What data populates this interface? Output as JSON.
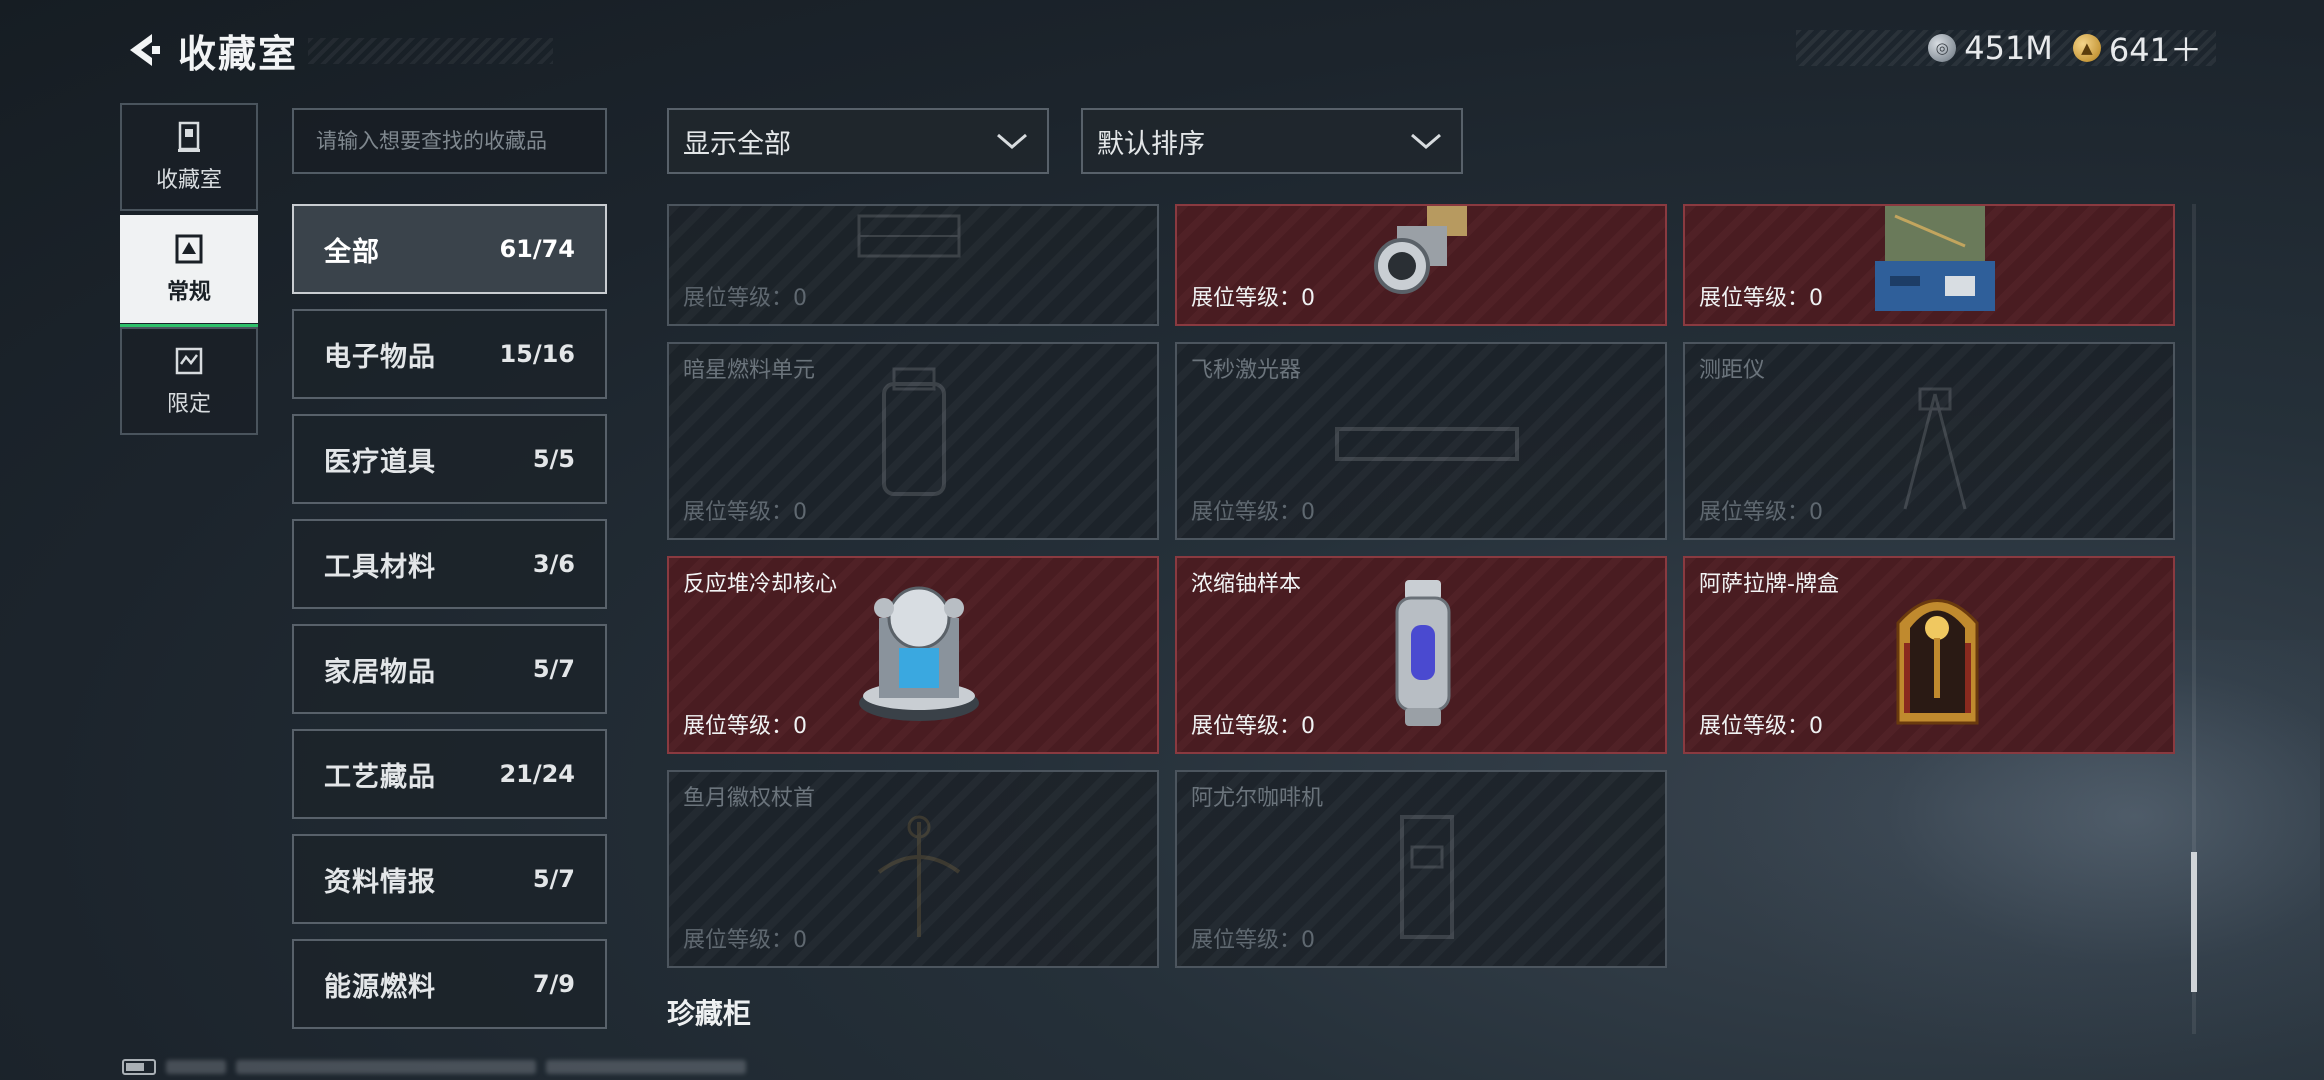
{
  "header": {
    "title": "收藏室",
    "currencies": [
      {
        "icon": "silver-coin-icon",
        "value": "451M"
      },
      {
        "icon": "gold-coin-icon",
        "value": "641＋"
      }
    ]
  },
  "left_nav": [
    {
      "label": "收藏室",
      "icon": "display-case-icon",
      "active": false
    },
    {
      "label": "常规",
      "icon": "regular-collection-icon",
      "active": true
    },
    {
      "label": "限定",
      "icon": "limited-collection-icon",
      "active": false
    }
  ],
  "search": {
    "placeholder": "请输入想要查找的收藏品",
    "value": ""
  },
  "categories": [
    {
      "name": "全部",
      "count": "61/74",
      "active": true
    },
    {
      "name": "电子物品",
      "count": "15/16",
      "active": false
    },
    {
      "name": "医疗道具",
      "count": "5/5",
      "active": false
    },
    {
      "name": "工具材料",
      "count": "3/6",
      "active": false
    },
    {
      "name": "家居物品",
      "count": "5/7",
      "active": false
    },
    {
      "name": "工艺藏品",
      "count": "21/24",
      "active": false
    },
    {
      "name": "资料情报",
      "count": "5/7",
      "active": false
    },
    {
      "name": "能源燃料",
      "count": "7/9",
      "active": false
    }
  ],
  "filters": {
    "display": "显示全部",
    "sort": "默认排序"
  },
  "items": [
    {
      "name": "",
      "level": "展位等级：0",
      "owned": false
    },
    {
      "name": "",
      "level": "展位等级：0",
      "owned": true
    },
    {
      "name": "",
      "level": "展位等级：0",
      "owned": true
    },
    {
      "name": "暗星燃料单元",
      "level": "展位等级：0",
      "owned": false
    },
    {
      "name": "飞秒激光器",
      "level": "展位等级：0",
      "owned": false
    },
    {
      "name": "测距仪",
      "level": "展位等级：0",
      "owned": false
    },
    {
      "name": "反应堆冷却核心",
      "level": "展位等级：0",
      "owned": true
    },
    {
      "name": "浓缩铀样本",
      "level": "展位等级：0",
      "owned": true
    },
    {
      "name": "阿萨拉牌-牌盒",
      "level": "展位等级：0",
      "owned": true
    },
    {
      "name": "鱼月徽权杖首",
      "level": "展位等级：0",
      "owned": false
    },
    {
      "name": "阿尤尔咖啡机",
      "level": "展位等级：0",
      "owned": false
    }
  ],
  "section_title": "珍藏柜",
  "colors": {
    "accent": "#2ec06a",
    "owned_card": "#4c1d22",
    "owned_border": "#8a3a40"
  }
}
